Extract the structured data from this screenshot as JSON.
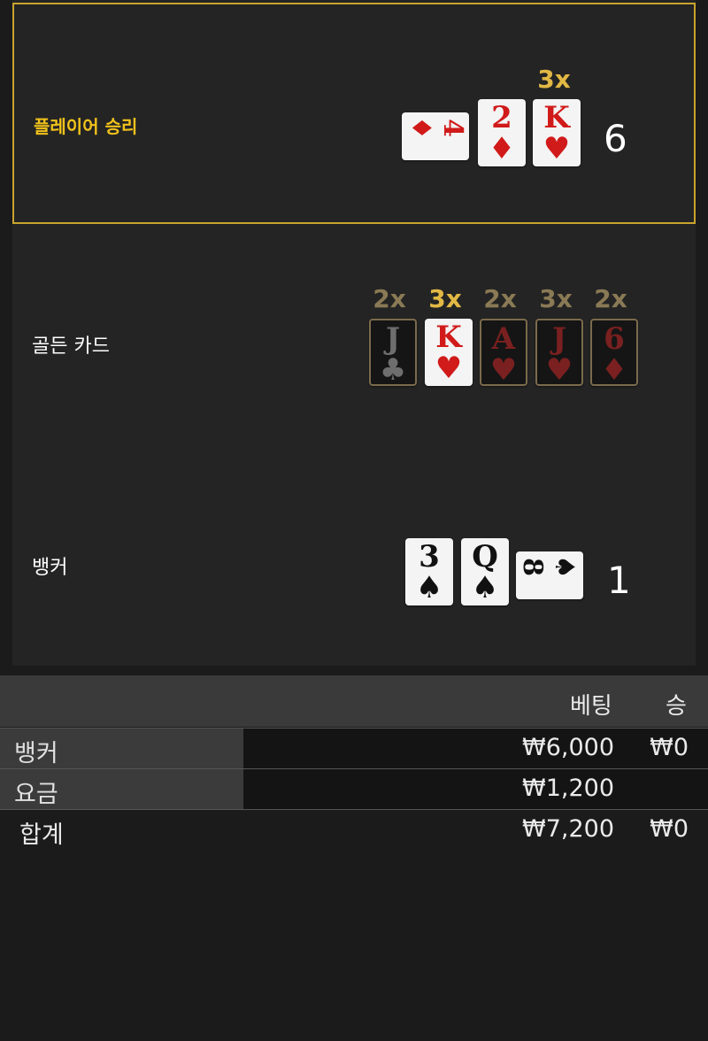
{
  "rows": {
    "player": {
      "label": "플레이어 승리",
      "score": "6",
      "multiplier": "3x",
      "cards": [
        {
          "rank": "4",
          "suit": "♦",
          "color": "red",
          "orientation": "horizontal"
        },
        {
          "rank": "2",
          "suit": "♦",
          "color": "red",
          "orientation": "vertical"
        },
        {
          "rank": "K",
          "suit": "♥",
          "color": "red",
          "orientation": "vertical"
        }
      ]
    },
    "golden": {
      "label": "골든 카드",
      "cards": [
        {
          "rank": "J",
          "suit": "♣",
          "color": "black",
          "multiplier": "2x",
          "active": false
        },
        {
          "rank": "K",
          "suit": "♥",
          "color": "red",
          "multiplier": "3x",
          "active": true
        },
        {
          "rank": "A",
          "suit": "♥",
          "color": "red",
          "multiplier": "2x",
          "active": false
        },
        {
          "rank": "J",
          "suit": "♥",
          "color": "red",
          "multiplier": "3x",
          "active": false
        },
        {
          "rank": "6",
          "suit": "♦",
          "color": "red",
          "multiplier": "2x",
          "active": false
        }
      ]
    },
    "banker": {
      "label": "뱅커",
      "score": "1",
      "cards": [
        {
          "rank": "3",
          "suit": "♠",
          "color": "black",
          "orientation": "vertical"
        },
        {
          "rank": "Q",
          "suit": "♠",
          "color": "black",
          "orientation": "vertical"
        },
        {
          "rank": "8",
          "suit": "♠",
          "color": "black",
          "orientation": "horizontal"
        }
      ]
    }
  },
  "table": {
    "headers": {
      "bet": "베팅",
      "win": "승"
    },
    "lines": [
      {
        "name": "뱅커",
        "bet": "₩6,000",
        "win": "₩0"
      },
      {
        "name": "요금",
        "bet": "₩1,200",
        "win": ""
      }
    ],
    "total": {
      "name": "합계",
      "bet": "₩7,200",
      "win": "₩0"
    }
  },
  "colors": {
    "gold": "#f1c21b",
    "red": "#d11a1a",
    "panel": "#242424"
  }
}
